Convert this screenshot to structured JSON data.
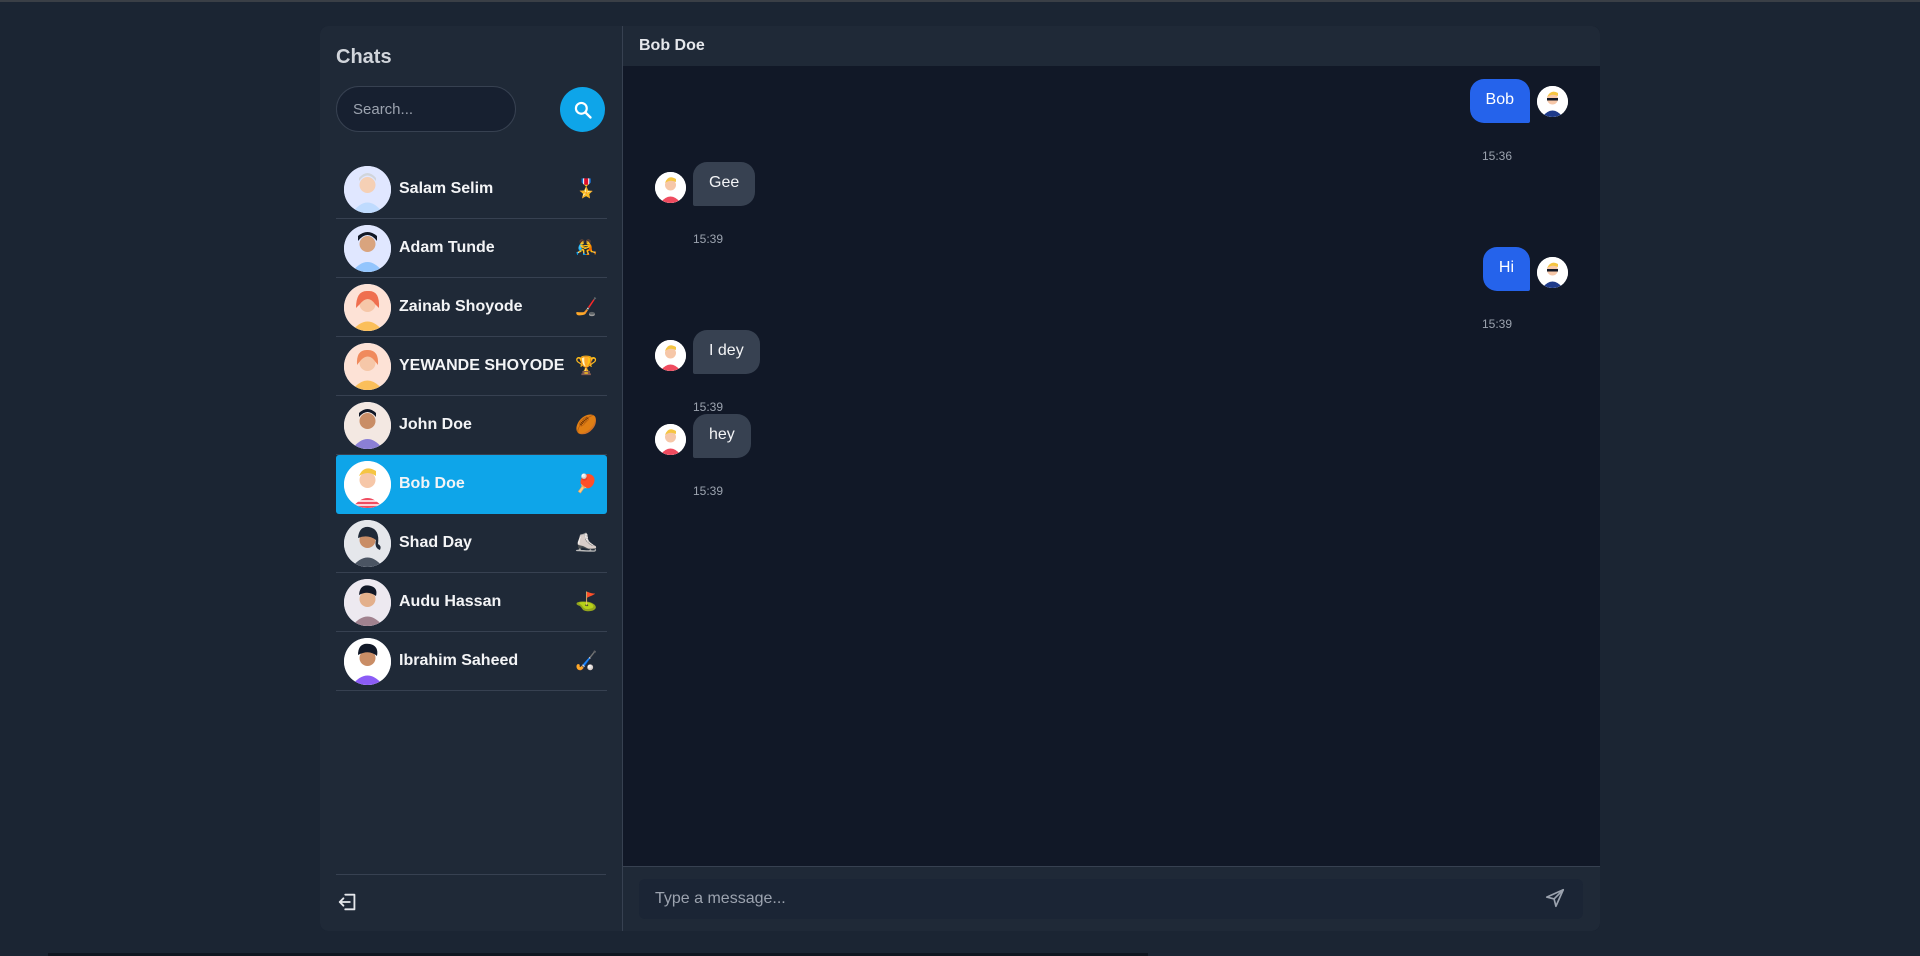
{
  "sidebar": {
    "title": "Chats",
    "search_placeholder": "Search...",
    "contacts": [
      {
        "name": "Salam Selim",
        "emoji": "🎖️"
      },
      {
        "name": "Adam Tunde",
        "emoji": "🤼"
      },
      {
        "name": "Zainab Shoyode",
        "emoji": "🏒"
      },
      {
        "name": "YEWANDE SHOYODE",
        "emoji": "🏆"
      },
      {
        "name": "John Doe",
        "emoji": "🏉"
      },
      {
        "name": "Bob Doe",
        "emoji": "🏓",
        "active": true
      },
      {
        "name": "Shad Day",
        "emoji": "⛸️"
      },
      {
        "name": "Audu Hassan",
        "emoji": "⛳"
      },
      {
        "name": "Ibrahim Saheed",
        "emoji": "🏑"
      }
    ]
  },
  "chat": {
    "header_name": "Bob Doe",
    "messages": [
      {
        "text": "Bob",
        "time": "15:36",
        "direction": "out"
      },
      {
        "text": "Gee",
        "time": "15:39",
        "direction": "in"
      },
      {
        "text": "Hi",
        "time": "15:39",
        "direction": "out"
      },
      {
        "text": "I dey",
        "time": "15:39",
        "direction": "in"
      },
      {
        "text": "hey",
        "time": "15:39",
        "direction": "in"
      }
    ],
    "composer_placeholder": "Type a message..."
  },
  "colors": {
    "accent": "#0ea5e9",
    "outgoing_bubble": "#2563eb",
    "incoming_bubble": "#374151",
    "background": "#111827"
  }
}
